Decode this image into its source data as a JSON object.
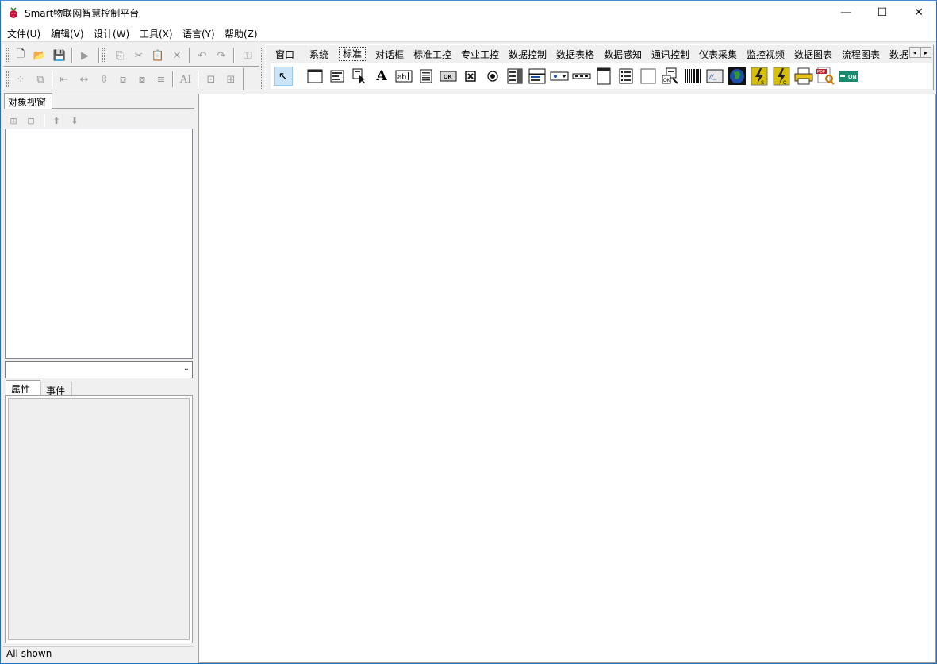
{
  "window": {
    "title": "Smart物联网智慧控制平台",
    "minimize_glyph": "—",
    "maximize_glyph": "☐",
    "close_glyph": "✕"
  },
  "menu": {
    "items": [
      "文件(U)",
      "编辑(V)",
      "设计(W)",
      "工具(X)",
      "语言(Y)",
      "帮助(Z)"
    ]
  },
  "toolbar": {
    "row1": [
      {
        "icon": "new-file-icon",
        "glyph": "🗋",
        "enabled": true
      },
      {
        "icon": "open-folder-icon",
        "glyph": "📂",
        "enabled": true
      },
      {
        "icon": "save-icon",
        "glyph": "💾",
        "enabled": false
      },
      {
        "icon": "run-icon",
        "glyph": "▶",
        "enabled": false
      },
      {
        "icon": "copy-icon",
        "glyph": "⎘",
        "enabled": false
      },
      {
        "icon": "cut-icon",
        "glyph": "✂",
        "enabled": false
      },
      {
        "icon": "paste-icon",
        "glyph": "📋",
        "enabled": false
      },
      {
        "icon": "delete-icon",
        "glyph": "✕",
        "enabled": false
      },
      {
        "icon": "undo-icon",
        "glyph": "↶",
        "enabled": false
      },
      {
        "icon": "redo-icon",
        "glyph": "↷",
        "enabled": false
      },
      {
        "icon": "key-icon",
        "glyph": "⚿",
        "enabled": false
      }
    ],
    "row2": [
      {
        "icon": "select-all-icon",
        "glyph": "⁘",
        "enabled": false
      },
      {
        "icon": "clone-icon",
        "glyph": "⧉",
        "enabled": false
      },
      {
        "icon": "align-left-icon",
        "glyph": "⇤",
        "enabled": false
      },
      {
        "icon": "same-width-icon",
        "glyph": "↔",
        "enabled": false
      },
      {
        "icon": "same-height-icon",
        "glyph": "⇳",
        "enabled": false
      },
      {
        "icon": "bring-front-icon",
        "glyph": "⧈",
        "enabled": false
      },
      {
        "icon": "send-back-icon",
        "glyph": "⧇",
        "enabled": false
      },
      {
        "icon": "distribute-icon",
        "glyph": "≡",
        "enabled": false
      },
      {
        "icon": "font-icon",
        "glyph": "AI",
        "enabled": false
      },
      {
        "icon": "center-h-icon",
        "glyph": "⊡",
        "enabled": false
      },
      {
        "icon": "center-v-icon",
        "glyph": "⊞",
        "enabled": false
      }
    ]
  },
  "palette": {
    "tabs": [
      "窗口",
      "系统",
      "标准",
      "对话框",
      "标准工控",
      "专业工控",
      "数据控制",
      "数据表格",
      "数据感知",
      "通讯控制",
      "仪表采集",
      "监控视频",
      "数据图表",
      "流程图表",
      "数据"
    ],
    "selected_tab": "标准",
    "scroll_left": "◂",
    "scroll_right": "▸",
    "components": [
      {
        "icon": "pointer-icon",
        "glyph": "↖"
      },
      {
        "icon": "form-window-icon",
        "glyph": "▭"
      },
      {
        "icon": "main-menu-icon",
        "glyph": "☰"
      },
      {
        "icon": "popup-menu-icon",
        "glyph": "▤"
      },
      {
        "icon": "label-icon",
        "glyph": "A"
      },
      {
        "icon": "edit-box-icon",
        "glyph": "ab"
      },
      {
        "icon": "memo-icon",
        "glyph": "≣"
      },
      {
        "icon": "button-icon",
        "glyph": "OK"
      },
      {
        "icon": "checkbox-icon",
        "glyph": "☒"
      },
      {
        "icon": "radio-button-icon",
        "glyph": "◉"
      },
      {
        "icon": "listbox-icon",
        "glyph": "▥"
      },
      {
        "icon": "combobox-icon",
        "glyph": "▦"
      },
      {
        "icon": "dropdown-icon",
        "glyph": "▾"
      },
      {
        "icon": "scrollbar-icon",
        "glyph": "▬"
      },
      {
        "icon": "groupbox-icon",
        "glyph": "▯"
      },
      {
        "icon": "radiogroup-icon",
        "glyph": "☷"
      },
      {
        "icon": "panel-icon",
        "glyph": "□"
      },
      {
        "icon": "action-list-icon",
        "glyph": "▧"
      },
      {
        "icon": "barcode-icon",
        "glyph": "|||"
      },
      {
        "icon": "static-text-icon",
        "glyph": "//"
      },
      {
        "icon": "globe-icon",
        "glyph": "🌐"
      },
      {
        "icon": "tcp-server-icon",
        "glyph": "ϟ"
      },
      {
        "icon": "tcp-client-icon",
        "glyph": "ϟ"
      },
      {
        "icon": "printer-icon",
        "glyph": "⎙"
      },
      {
        "icon": "pdf-preview-icon",
        "glyph": "PDF"
      },
      {
        "icon": "toggle-switch-icon",
        "glyph": "ON"
      }
    ]
  },
  "left_panel": {
    "object_tab": "对象视窗",
    "tree_tools": [
      {
        "icon": "expand-all-icon",
        "glyph": "⊞"
      },
      {
        "icon": "collapse-all-icon",
        "glyph": "⊟"
      },
      {
        "icon": "move-up-icon",
        "glyph": "⬆"
      },
      {
        "icon": "move-down-icon",
        "glyph": "⬇"
      }
    ],
    "combo_value": "",
    "combo_arrow": "⌄",
    "property_tab": "属性",
    "event_tab": "事件",
    "status": "All shown"
  },
  "colors": {
    "window_border": "#2b6fb3",
    "selected_tool_bg": "#cce4f7",
    "toggle_green": "#1a8a6e",
    "globe_blue": "#1e4fa8",
    "tcp_yellow": "#d8c000",
    "printer_yellow": "#e8c21a"
  }
}
